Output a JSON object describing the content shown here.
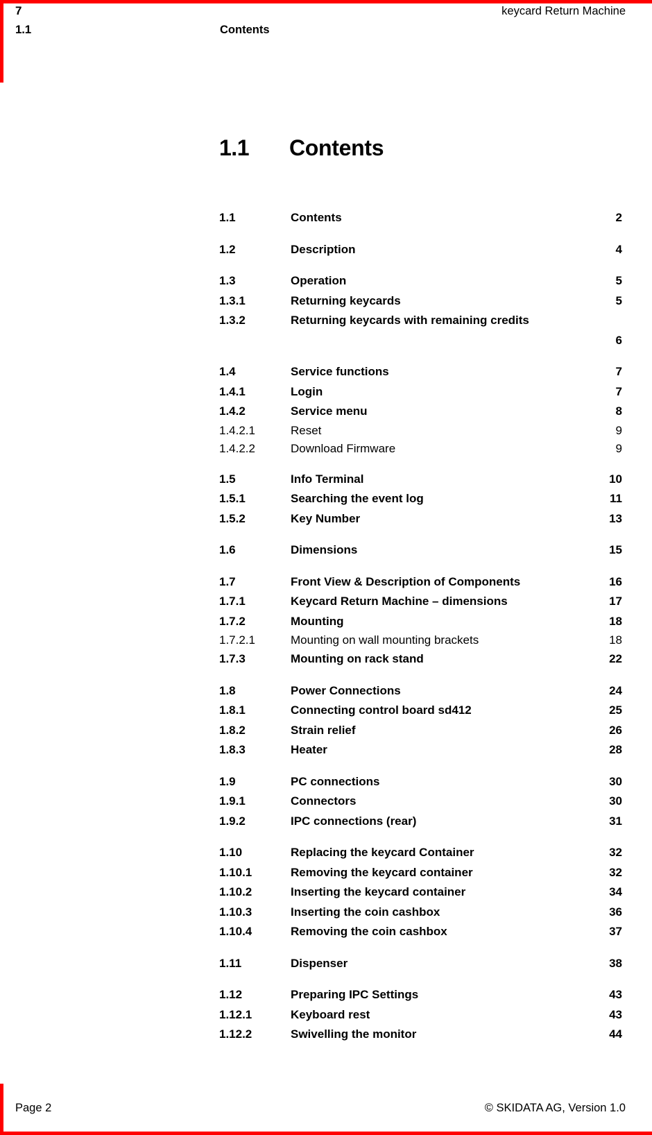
{
  "accent_color": "#ff0000",
  "header": {
    "chapter_number": "7",
    "document_title": "keycard Return Machine",
    "section_number": "1.1",
    "section_title": "Contents"
  },
  "heading": {
    "number": "1.1",
    "text": "Contents"
  },
  "toc": {
    "groups": [
      {
        "entries": [
          {
            "number": "1.1",
            "title": "Contents",
            "page": "2",
            "level": 2
          }
        ]
      },
      {
        "entries": [
          {
            "number": "1.2",
            "title": "Description",
            "page": "4",
            "level": 2
          }
        ]
      },
      {
        "entries": [
          {
            "number": "1.3",
            "title": "Operation",
            "page": "5",
            "level": 2
          },
          {
            "number": "1.3.1",
            "title": "Returning keycards",
            "page": "5",
            "level": 3
          },
          {
            "number": "1.3.2",
            "title": "Returning keycards with remaining credits",
            "page": "6",
            "level": 3,
            "wrapped": true
          }
        ]
      },
      {
        "entries": [
          {
            "number": "1.4",
            "title": "Service functions",
            "page": "7",
            "level": 2
          },
          {
            "number": "1.4.1",
            "title": "Login",
            "page": "7",
            "level": 3
          },
          {
            "number": "1.4.2",
            "title": "Service menu",
            "page": "8",
            "level": 3
          },
          {
            "number": "1.4.2.1",
            "title": "Reset",
            "page": "9",
            "level": 4
          },
          {
            "number": "1.4.2.2",
            "title": "Download Firmware",
            "page": "9",
            "level": 4
          }
        ]
      },
      {
        "entries": [
          {
            "number": "1.5",
            "title": "Info Terminal",
            "page": "10",
            "level": 2
          },
          {
            "number": "1.5.1",
            "title": "Searching the event log",
            "page": "11",
            "level": 3
          },
          {
            "number": "1.5.2",
            "title": "Key Number",
            "page": "13",
            "level": 3
          }
        ]
      },
      {
        "entries": [
          {
            "number": "1.6",
            "title": "Dimensions",
            "page": "15",
            "level": 2
          }
        ]
      },
      {
        "entries": [
          {
            "number": "1.7",
            "title": "Front View & Description of Components",
            "page": "16",
            "level": 2,
            "wide": true
          },
          {
            "number": "1.7.1",
            "title": "Keycard Return Machine – dimensions",
            "page": "17",
            "level": 3
          },
          {
            "number": "1.7.2",
            "title": "Mounting",
            "page": "18",
            "level": 3
          },
          {
            "number": "1.7.2.1",
            "title": "Mounting on wall mounting brackets",
            "page": "18",
            "level": 4
          },
          {
            "number": "1.7.3",
            "title": "Mounting on rack stand",
            "page": "22",
            "level": 3
          }
        ]
      },
      {
        "entries": [
          {
            "number": "1.8",
            "title": "Power Connections",
            "page": "24",
            "level": 2
          },
          {
            "number": "1.8.1",
            "title": "Connecting control board sd412",
            "page": "25",
            "level": 3
          },
          {
            "number": "1.8.2",
            "title": "Strain relief",
            "page": "26",
            "level": 3
          },
          {
            "number": "1.8.3",
            "title": "Heater",
            "page": "28",
            "level": 3
          }
        ]
      },
      {
        "entries": [
          {
            "number": "1.9",
            "title": "PC connections",
            "page": "30",
            "level": 2
          },
          {
            "number": "1.9.1",
            "title": "Connectors",
            "page": "30",
            "level": 3
          },
          {
            "number": "1.9.2",
            "title": "IPC connections (rear)",
            "page": "31",
            "level": 3
          }
        ]
      },
      {
        "entries": [
          {
            "number": "1.10",
            "title": "Replacing the keycard Container",
            "page": "32",
            "level": 2
          },
          {
            "number": "1.10.1",
            "title": "Removing the keycard container",
            "page": "32",
            "level": 3
          },
          {
            "number": "1.10.2",
            "title": "Inserting the keycard container",
            "page": "34",
            "level": 3
          },
          {
            "number": "1.10.3",
            "title": "Inserting the coin cashbox",
            "page": "36",
            "level": 3
          },
          {
            "number": "1.10.4",
            "title": "Removing the coin cashbox",
            "page": "37",
            "level": 3
          }
        ]
      },
      {
        "entries": [
          {
            "number": "1.11",
            "title": "Dispenser",
            "page": "38",
            "level": 2
          }
        ]
      },
      {
        "entries": [
          {
            "number": "1.12",
            "title": "Preparing IPC Settings",
            "page": "43",
            "level": 2
          },
          {
            "number": "1.12.1",
            "title": "Keyboard rest",
            "page": "43",
            "level": 3
          },
          {
            "number": "1.12.2",
            "title": "Swivelling the monitor",
            "page": "44",
            "level": 3
          }
        ]
      }
    ]
  },
  "footer": {
    "page_label": "Page 2",
    "copyright": "© SKIDATA AG, Version 1.0"
  }
}
